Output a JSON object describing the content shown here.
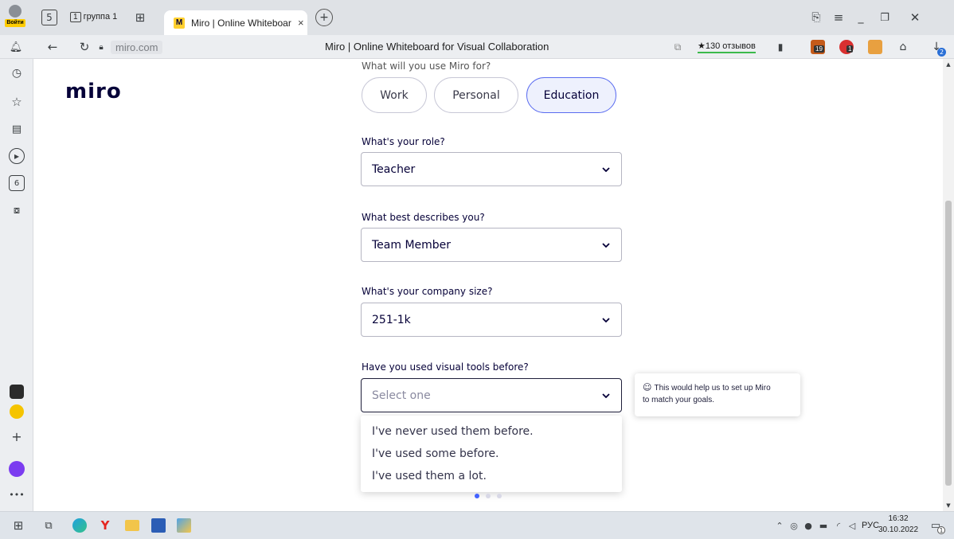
{
  "browser": {
    "profile_label": "Войти",
    "group_tab": {
      "count": "1",
      "label": "группа 1"
    },
    "active_tab": {
      "title": "Miro | Online Whiteboar",
      "close": "×"
    },
    "new_tab": "+",
    "url": "miro.com",
    "page_title": "Miro | Online Whiteboard for Visual Collaboration",
    "reviews": "★130 отзывов",
    "badges": {
      "ext1": "19",
      "ext2": "1",
      "download": "2"
    }
  },
  "page": {
    "logo": "miro",
    "use_question": "What will you use Miro for?",
    "use_options": [
      {
        "label": "Work",
        "selected": false
      },
      {
        "label": "Personal",
        "selected": false
      },
      {
        "label": "Education",
        "selected": true
      }
    ],
    "role": {
      "label": "What's your role?",
      "value": "Teacher"
    },
    "describes": {
      "label": "What best describes you?",
      "value": "Team Member"
    },
    "company": {
      "label": "What's your company size?",
      "value": "251-1k"
    },
    "visual": {
      "label": "Have you used visual tools before?",
      "placeholder": "Select one",
      "options": [
        "I've never used them before.",
        "I've used some before.",
        "I've used them a lot."
      ]
    },
    "tooltip": {
      "icon": "☺",
      "line1": "This would help us to set up Miro",
      "line2": "to match your goals."
    },
    "step": {
      "current": 1,
      "total": 3
    }
  },
  "taskbar": {
    "lang": "РУС",
    "time": "16:32",
    "date": "30.10.2022",
    "notifications": "1"
  },
  "colors": {
    "accent": "#4262ff",
    "selected_bg": "#eef1fd",
    "text": "#050038"
  }
}
